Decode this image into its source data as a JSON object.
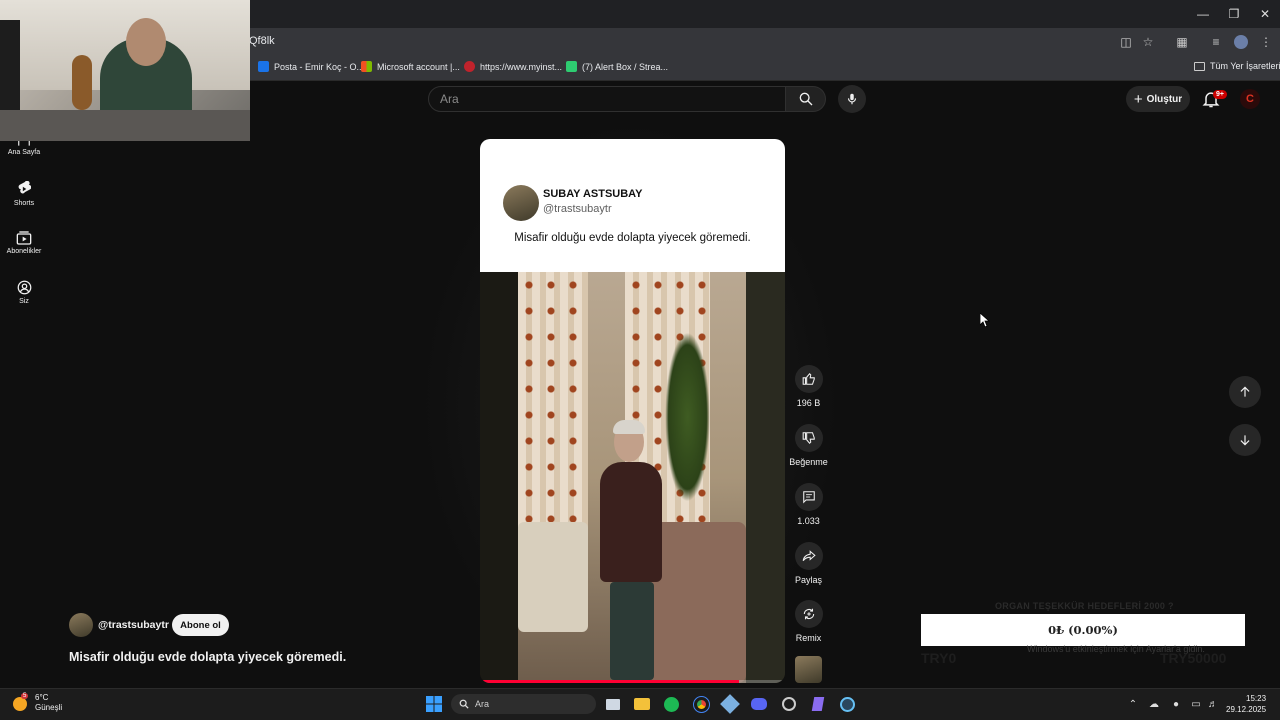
{
  "browser": {
    "url": "Qf8lk",
    "bookmarks": [
      {
        "label": "Posta - Emir Koç - O...",
        "color": "#1a73e8"
      },
      {
        "label": "Microsoft account |...",
        "color": "#f25022"
      },
      {
        "label": "https://www.myinst...",
        "color": "#c0232c"
      },
      {
        "label": "(7) Alert Box / Strea...",
        "color": "#2ecc71"
      }
    ],
    "all_bookmarks": "Tüm Yer İşaretleri"
  },
  "header": {
    "search_placeholder": "Ara",
    "create_label": "Oluştur",
    "notif_badge": "9+",
    "avatar_letter": "C"
  },
  "sidebar": {
    "items": [
      {
        "label": "Ana Sayfa",
        "icon": "home-icon"
      },
      {
        "label": "Shorts",
        "icon": "shorts-icon"
      },
      {
        "label": "Abonelikler",
        "icon": "subscriptions-icon"
      },
      {
        "label": "Siz",
        "icon": "you-icon"
      }
    ]
  },
  "short": {
    "card_channel_name": "SUBAY ASTSUBAY",
    "card_handle": "@trastsubaytr",
    "card_text": "Misafir olduğu evde dolapta yiyecek göremedi.",
    "progress": 0.85
  },
  "actions": {
    "like_count": "196 B",
    "dislike_label": "Beğenme",
    "comment_count": "1.033",
    "share_label": "Paylaş",
    "remix_label": "Remix"
  },
  "channel": {
    "handle": "@trastsubaytr",
    "subscribe_label": "Abone ol",
    "title": "Misafir olduğu evde dolapta yiyecek göremedi."
  },
  "donation": {
    "title": "ORGAN TEŞEKKÜR HEDEFLERİ 2000 ?",
    "value": "0₺ (0.00%)",
    "left": "TRY0",
    "right": "TRY50000",
    "windows_activation": "Windows'u etkinleştirmek için Ayarlar'a gidin."
  },
  "taskbar": {
    "temp": "6°C",
    "weather": "Güneşli",
    "weather_badge": "5",
    "search_placeholder": "Ara",
    "time": "15:23",
    "date": "29.12.2025"
  }
}
